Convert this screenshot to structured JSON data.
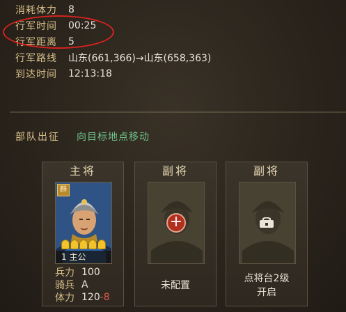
{
  "info": [
    {
      "label": "消耗体力",
      "value": "8"
    },
    {
      "label": "行军时间",
      "value": "00:25"
    },
    {
      "label": "行军距离",
      "value": "5"
    },
    {
      "label": "行军路线",
      "value": "山东(661,366)→山东(658,363)"
    },
    {
      "label": "到达时间",
      "value": "12:13:18"
    }
  ],
  "section": {
    "title": "部队出征",
    "subtitle": "向目标地点移动"
  },
  "cards": {
    "main": {
      "title": "主将",
      "badge": "群",
      "level_name": "1 主公",
      "stars": 5,
      "stats": [
        {
          "label": "兵力",
          "value": "100"
        },
        {
          "label": "骑兵",
          "value": "A"
        },
        {
          "label": "体力",
          "value": "120",
          "extra": "-8"
        }
      ]
    },
    "deputy1": {
      "title": "副将",
      "status": "未配置"
    },
    "deputy2": {
      "title": "副将",
      "status_line1": "点将台2级",
      "status_line2": "开启"
    }
  },
  "colors": {
    "label_gold": "#d8c08a",
    "status_green": "#6fc48a",
    "annotation_red": "#d8231f"
  }
}
